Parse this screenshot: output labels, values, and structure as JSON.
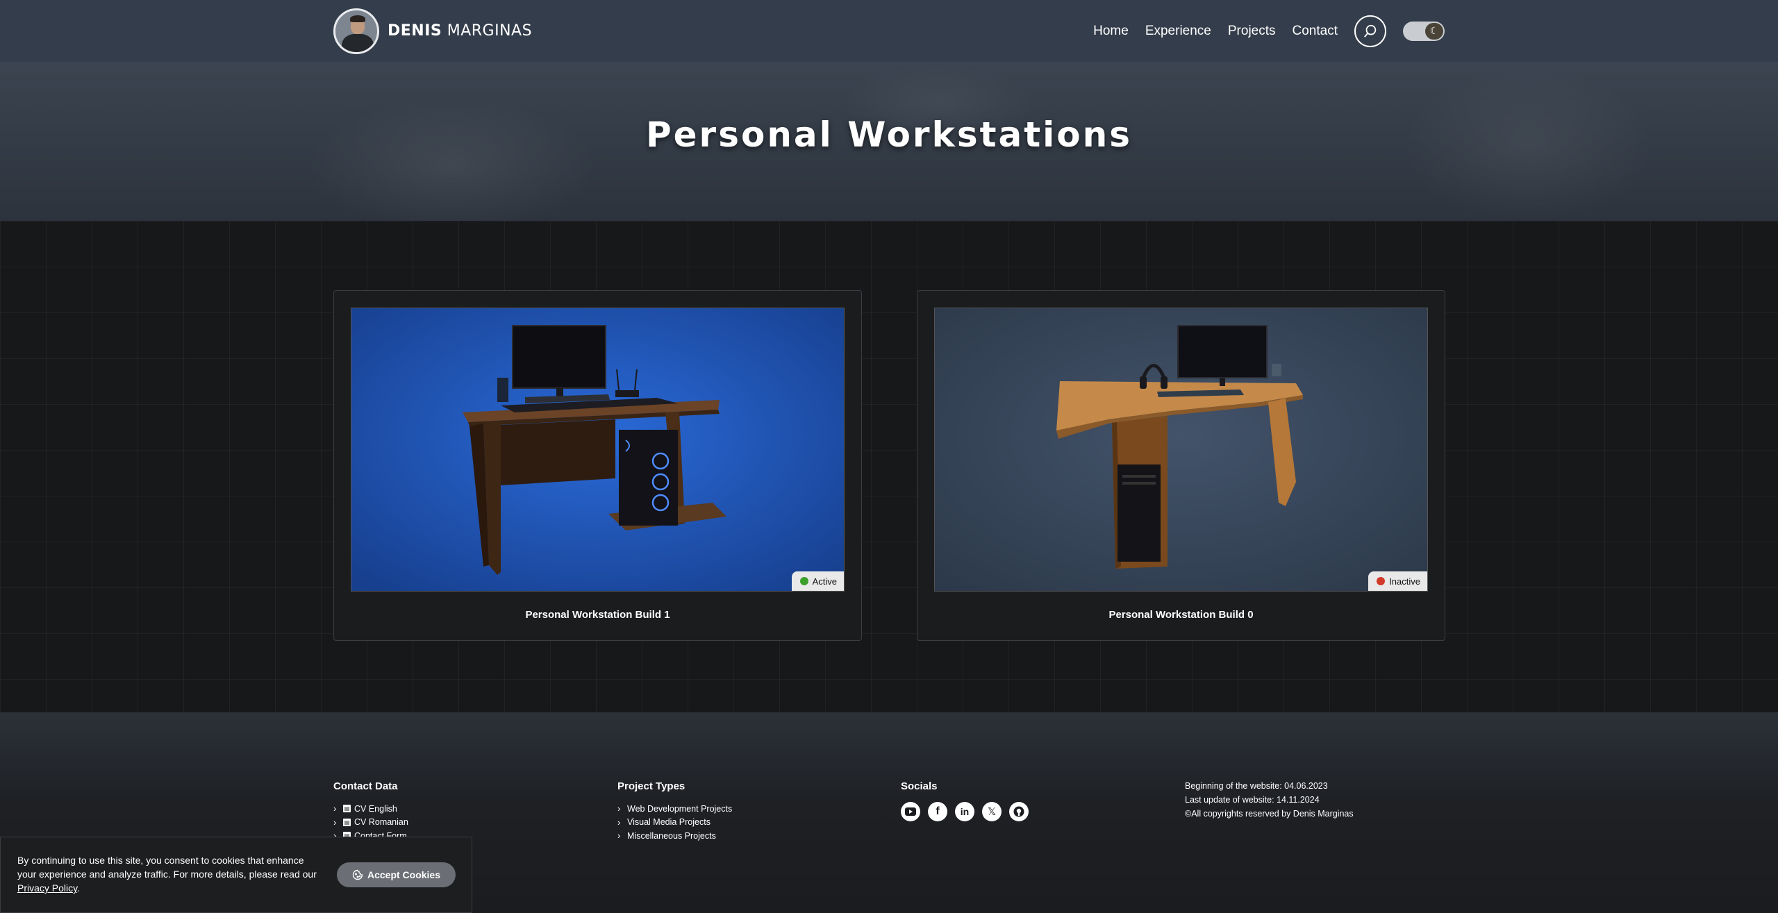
{
  "nav": {
    "brand_bold": "DENIS",
    "brand_light": " MARGINAS",
    "links": [
      "Home",
      "Experience",
      "Projects",
      "Contact"
    ],
    "theme_icon": "moon-icon"
  },
  "hero": {
    "title": "Personal Workstations"
  },
  "cards": [
    {
      "status": "Active",
      "status_color": "#3aa02a",
      "title": "Personal Workstation Build 1",
      "bg": "#1e4fae"
    },
    {
      "status": "Inactive",
      "status_color": "#d23a2a",
      "title": "Personal Workstation Build 0",
      "bg": "#354457"
    }
  ],
  "footer": {
    "contact": {
      "heading": "Contact Data",
      "items": [
        "CV English",
        "CV Romanian",
        "Contact Form"
      ]
    },
    "projects": {
      "heading": "Project Types",
      "items": [
        "Web Development Projects",
        "Visual Media Projects",
        "Miscellaneous Projects"
      ]
    },
    "socials": {
      "heading": "Socials",
      "icons": [
        "youtube-icon",
        "facebook-icon",
        "linkedin-icon",
        "x-icon",
        "github-icon"
      ]
    },
    "info": {
      "begin": "Beginning of the website: 04.06.2023",
      "update": "Last update of website: 14.11.2024",
      "copyright": "©All copyrights reserved by Denis Marginas"
    }
  },
  "cookie": {
    "text": "By continuing to use this site, you consent to cookies that enhance your experience and analyze traffic. For more details, please read our ",
    "link": "Privacy Policy",
    "end": ".",
    "button": "Accept Cookies"
  }
}
